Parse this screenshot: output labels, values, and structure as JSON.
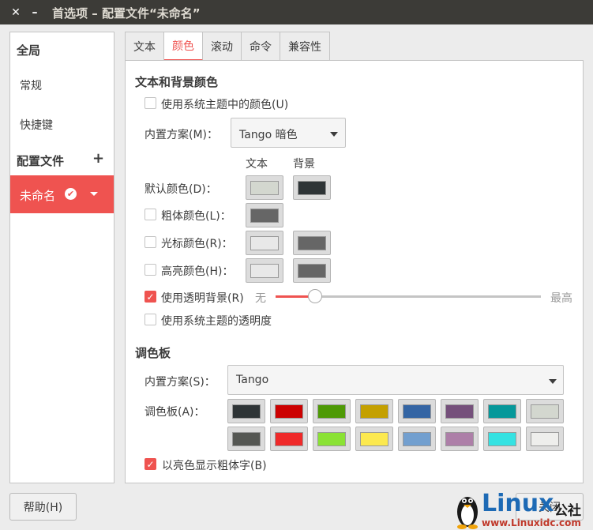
{
  "window": {
    "title": "首选项 – 配置文件“未命名”",
    "close_glyph": "✕",
    "minimize_glyph": "–"
  },
  "sidebar": {
    "global_heading": "全局",
    "items": [
      {
        "label": "常规"
      },
      {
        "label": "快捷键"
      }
    ],
    "profiles_heading": "配置文件",
    "add_glyph": "+",
    "profile": {
      "label": "未命名",
      "check_glyph": "✔"
    }
  },
  "tabs": [
    {
      "label": "文本",
      "active": false
    },
    {
      "label": "颜色",
      "active": true
    },
    {
      "label": "滚动",
      "active": false
    },
    {
      "label": "命令",
      "active": false
    },
    {
      "label": "兼容性",
      "active": false
    }
  ],
  "colors_section": {
    "title": "文本和背景颜色",
    "use_system_theme": {
      "label": "使用系统主题中的颜色(U)",
      "checked": false
    },
    "builtin_scheme_label": "内置方案(M)：",
    "builtin_scheme_value": "Tango 暗色",
    "col_text": "文本",
    "col_background": "背景",
    "rows": [
      {
        "label": "默认颜色(D)：",
        "has_checkbox": false,
        "checked": false,
        "text_color": "#d3d7cf",
        "bg_color": "#2e3436"
      },
      {
        "label": "粗体颜色(L)：",
        "has_checkbox": true,
        "checked": false,
        "text_color": "#666666",
        "bg_color": null
      },
      {
        "label": "光标颜色(R)：",
        "has_checkbox": true,
        "checked": false,
        "text_color": "#e8e8e8",
        "bg_color": "#666666"
      },
      {
        "label": "高亮颜色(H)：",
        "has_checkbox": true,
        "checked": false,
        "text_color": "#e8e8e8",
        "bg_color": "#666666"
      }
    ],
    "transparent_bg": {
      "label": "使用透明背景(R)",
      "checked": true,
      "min_label": "无",
      "max_label": "最高",
      "level": 0.15
    },
    "system_transparency": {
      "label": "使用系统主题的透明度",
      "checked": false
    }
  },
  "palette_section": {
    "title": "调色板",
    "builtin_scheme_label": "内置方案(S)：",
    "builtin_scheme_value": "Tango",
    "palette_label": "调色板(A)：",
    "row1": [
      "#2e3436",
      "#cc0000",
      "#4e9a06",
      "#c4a000",
      "#3465a4",
      "#75507b",
      "#06989a",
      "#d3d7cf"
    ],
    "row2": [
      "#555753",
      "#ef2929",
      "#8ae234",
      "#fce94f",
      "#729fcf",
      "#ad7fa8",
      "#34e2e2",
      "#eeeeec"
    ],
    "bold_bright": {
      "label": "以亮色显示粗体字(B)",
      "checked": true
    }
  },
  "footer": {
    "help_label": "帮助(H)",
    "close_label": "关闭"
  },
  "watermark": {
    "brand": "Linux",
    "cn": "公社",
    "url": "www.Linuxidc.com"
  },
  "accent_color": "#ef5350"
}
